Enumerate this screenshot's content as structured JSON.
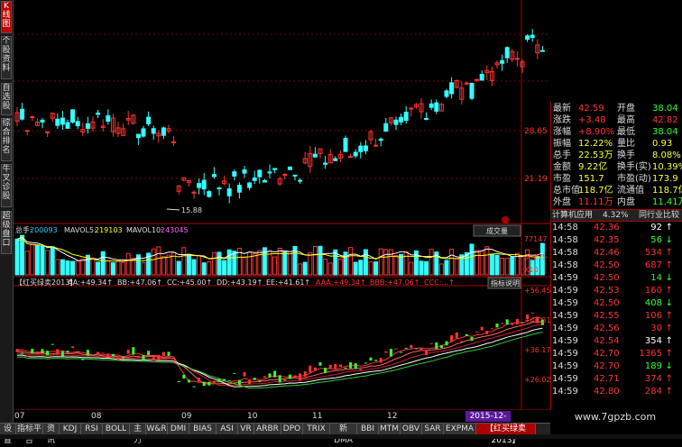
{
  "leftbar": {
    "buttons": [
      "K线图",
      "个股资料",
      "自选股",
      "综合排名",
      "牛叉诊股",
      "超级盘口"
    ]
  },
  "price_chart": {
    "right_labels": [
      "28.65",
      "21.19"
    ],
    "low_marker": "15.88"
  },
  "volume_panel": {
    "label_total": "总手:",
    "total_value": "200093",
    "mavol5_label": "MAVOL5:",
    "mavol5_value": "219103",
    "mavol10_label": "MAVOL10:",
    "mavol10_value": "243045",
    "button": "成交量",
    "right_labels": [
      "77147",
      "39275",
      "X10"
    ]
  },
  "indicator_panel": {
    "name": "【红买绿卖2013】",
    "values": [
      {
        "label": "AA:",
        "value": "+49.34"
      },
      {
        "label": "BB:",
        "value": "+47.06"
      },
      {
        "label": "CC:",
        "value": "+45.00"
      },
      {
        "label": "DD:",
        "value": "+43.19"
      },
      {
        "label": "EE:",
        "value": "+41.61"
      },
      {
        "label": "AAA:",
        "value": "+49.34"
      },
      {
        "label": "BBB:",
        "value": "+47.06"
      },
      {
        "label": "CCC:",
        "value": "..."
      }
    ],
    "button": "指标说明",
    "right_labels": [
      "+56.45",
      "+46.31",
      "+36.17",
      "+26.02"
    ]
  },
  "x_axis": [
    "07",
    "08",
    "09",
    "10",
    "11",
    "12"
  ],
  "date_tag": "2015-12-30/三",
  "info": {
    "rows": [
      {
        "l1": "最新",
        "v1": "42.59",
        "c1": "red",
        "l2": "开盘",
        "v2": "38.04",
        "c2": "green"
      },
      {
        "l1": "涨跌",
        "v1": "+3.48",
        "c1": "red",
        "l2": "最高",
        "v2": "42.82",
        "c2": "red"
      },
      {
        "l1": "涨幅",
        "v1": "+8.90%",
        "c1": "red",
        "l2": "最低",
        "v2": "38.04",
        "c2": "green"
      },
      {
        "l1": "振幅",
        "v1": "12.22%",
        "c1": "yellow",
        "l2": "量比",
        "v2": "0.93",
        "c2": "yellow"
      },
      {
        "l1": "总手",
        "v1": "22.53万",
        "c1": "yellow",
        "l2": "换手",
        "v2": "8.08%",
        "c2": "yellow"
      },
      {
        "l1": "金额",
        "v1": "9.22亿",
        "c1": "yellow",
        "l2": "换手(实)",
        "v2": "10.39%",
        "c2": "yellow"
      },
      {
        "l1": "市盈",
        "v1": "151.7",
        "c1": "yellow",
        "l2": "市盈(动)",
        "v2": "173.9",
        "c2": "yellow"
      },
      {
        "l1": "总市值",
        "v1": "118.7亿",
        "c1": "yellow",
        "l2": "流通值",
        "v2": "118.7亿",
        "c2": "yellow"
      },
      {
        "l1": "外盘",
        "v1": "11.11万",
        "c1": "red",
        "l2": "内盘",
        "v2": "11.41万",
        "c2": "green"
      }
    ],
    "tabs": {
      "sector": "计算机应用",
      "pct": "4.32%",
      "compare": "同行业比较"
    },
    "trades": [
      {
        "time": "14:58",
        "price": "42.36",
        "vol": "92",
        "dir": "up",
        "vcolor": "white"
      },
      {
        "time": "14:58",
        "price": "42.35",
        "vol": "56",
        "dir": "down",
        "vcolor": "green"
      },
      {
        "time": "14:58",
        "price": "42.46",
        "vol": "534",
        "dir": "up",
        "vcolor": "red"
      },
      {
        "time": "14:58",
        "price": "42.50",
        "vol": "687",
        "dir": "up",
        "vcolor": "red"
      },
      {
        "time": "14:59",
        "price": "42.50",
        "vol": "14",
        "dir": "down",
        "vcolor": "green"
      },
      {
        "time": "14:59",
        "price": "42.53",
        "vol": "160",
        "dir": "up",
        "vcolor": "red"
      },
      {
        "time": "14:59",
        "price": "42.50",
        "vol": "408",
        "dir": "down",
        "vcolor": "green"
      },
      {
        "time": "14:59",
        "price": "42.55",
        "vol": "106",
        "dir": "up",
        "vcolor": "red"
      },
      {
        "time": "14:59",
        "price": "42.56",
        "vol": "30",
        "dir": "up",
        "vcolor": "red"
      },
      {
        "time": "14:59",
        "price": "42.54",
        "vol": "354",
        "dir": "up",
        "vcolor": "white"
      },
      {
        "time": "14:59",
        "price": "42.70",
        "vol": "1365",
        "dir": "up",
        "vcolor": "red"
      },
      {
        "time": "14:59",
        "price": "42.70",
        "vol": "189",
        "dir": "down",
        "vcolor": "green"
      },
      {
        "time": "14:59",
        "price": "42.71",
        "vol": "374",
        "dir": "up",
        "vcolor": "red"
      },
      {
        "time": "14:59",
        "price": "42.80",
        "vol": "284",
        "dir": "up",
        "vcolor": "red"
      }
    ]
  },
  "tabbar": [
    "设置",
    "指标平台",
    "资讯",
    "KDJ",
    "RSI",
    "BOLL",
    "主力",
    "W&R",
    "DMI",
    "BIAS",
    "ASI",
    "VR",
    "ARBR",
    "DPO",
    "TRIX",
    "新DMA",
    "BBI",
    "MTM",
    "OBV",
    "SAR",
    "EXPMA",
    "【红买绿卖2013】"
  ],
  "watermark": "www.7gpzb.com",
  "colors": {
    "up": "#ff3333",
    "down": "#33ffff",
    "ma_white": "#ffffff",
    "ma_yellow": "#ffff00",
    "ma_purple": "#ff00ff",
    "green_line": "#33cc33"
  }
}
